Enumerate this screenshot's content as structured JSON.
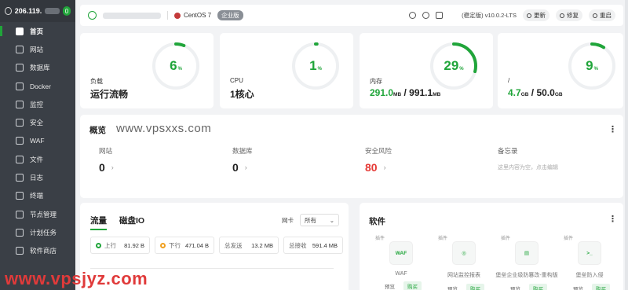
{
  "sidebar": {
    "server_ip": "206.119.",
    "badge": "0",
    "items": [
      {
        "label": "首页",
        "icon": "home-icon"
      },
      {
        "label": "网站",
        "icon": "globe-icon"
      },
      {
        "label": "数据库",
        "icon": "database-icon"
      },
      {
        "label": "Docker",
        "icon": "docker-icon"
      },
      {
        "label": "监控",
        "icon": "monitor-icon"
      },
      {
        "label": "安全",
        "icon": "shield-icon"
      },
      {
        "label": "WAF",
        "icon": "firewall-icon"
      },
      {
        "label": "文件",
        "icon": "folder-icon"
      },
      {
        "label": "日志",
        "icon": "log-icon"
      },
      {
        "label": "终端",
        "icon": "terminal-icon"
      },
      {
        "label": "节点管理",
        "icon": "node-icon"
      },
      {
        "label": "计划任务",
        "icon": "calendar-icon"
      },
      {
        "label": "软件商店",
        "icon": "store-icon"
      }
    ]
  },
  "topbar": {
    "os": "CentOS 7",
    "edition_tag": "企业版",
    "version": "(稳定版) v10.0.2-LTS",
    "update_label": "更新",
    "repair_label": "修复",
    "restart_label": "重启"
  },
  "stats": [
    {
      "label": "负载",
      "value": "运行流畅",
      "percent": 6
    },
    {
      "label": "CPU",
      "value": "1核心",
      "percent": 1
    },
    {
      "label": "内存",
      "used": "291.0",
      "used_unit": "MB",
      "sep": " / ",
      "total": "991.1",
      "total_unit": "MB",
      "percent": 29
    },
    {
      "label": "/",
      "used": "4.7",
      "used_unit": "GB",
      "sep": " / ",
      "total": "50.0",
      "total_unit": "GB",
      "percent": 9
    }
  ],
  "colors": {
    "accent": "#20a53a",
    "danger": "#e53935",
    "sidebar_bg": "#3a3f46"
  },
  "overview": {
    "title": "概览",
    "watermark": "www.vpsxxs.com",
    "items": [
      {
        "label": "网站",
        "value": "0"
      },
      {
        "label": "数据库",
        "value": "0"
      },
      {
        "label": "安全风险",
        "value": "80"
      },
      {
        "label": "备忘录",
        "hint": "这里内容为空，点击编辑"
      }
    ]
  },
  "traffic": {
    "tabs": [
      "流量",
      "磁盘IO"
    ],
    "nic_label": "网卡",
    "nic_value": "所有",
    "stats": [
      {
        "label": "上行",
        "value": "81.92 B"
      },
      {
        "label": "下行",
        "value": "471.04 B"
      },
      {
        "label": "总发送",
        "value": "13.2 MB"
      },
      {
        "label": "总接收",
        "value": "591.4 MB"
      }
    ]
  },
  "software": {
    "title": "软件",
    "items": [
      {
        "tag": "插件",
        "icon_text": "WAF",
        "name": "WAF",
        "btn1": "预览",
        "btn2": "购买"
      },
      {
        "tag": "插件",
        "icon_text": "◎",
        "name": "网站监控报表",
        "btn1": "预览",
        "btn2": "购买"
      },
      {
        "tag": "插件",
        "icon_text": "▤",
        "name": "堡垒企业级防篡改-重构版",
        "btn1": "预览",
        "btn2": "购买"
      },
      {
        "tag": "插件",
        "icon_text": ">_",
        "name": "堡垒防入侵",
        "btn1": "预览",
        "btn2": "购买"
      }
    ]
  },
  "bottom_watermark": "www.vpsjyz.com"
}
